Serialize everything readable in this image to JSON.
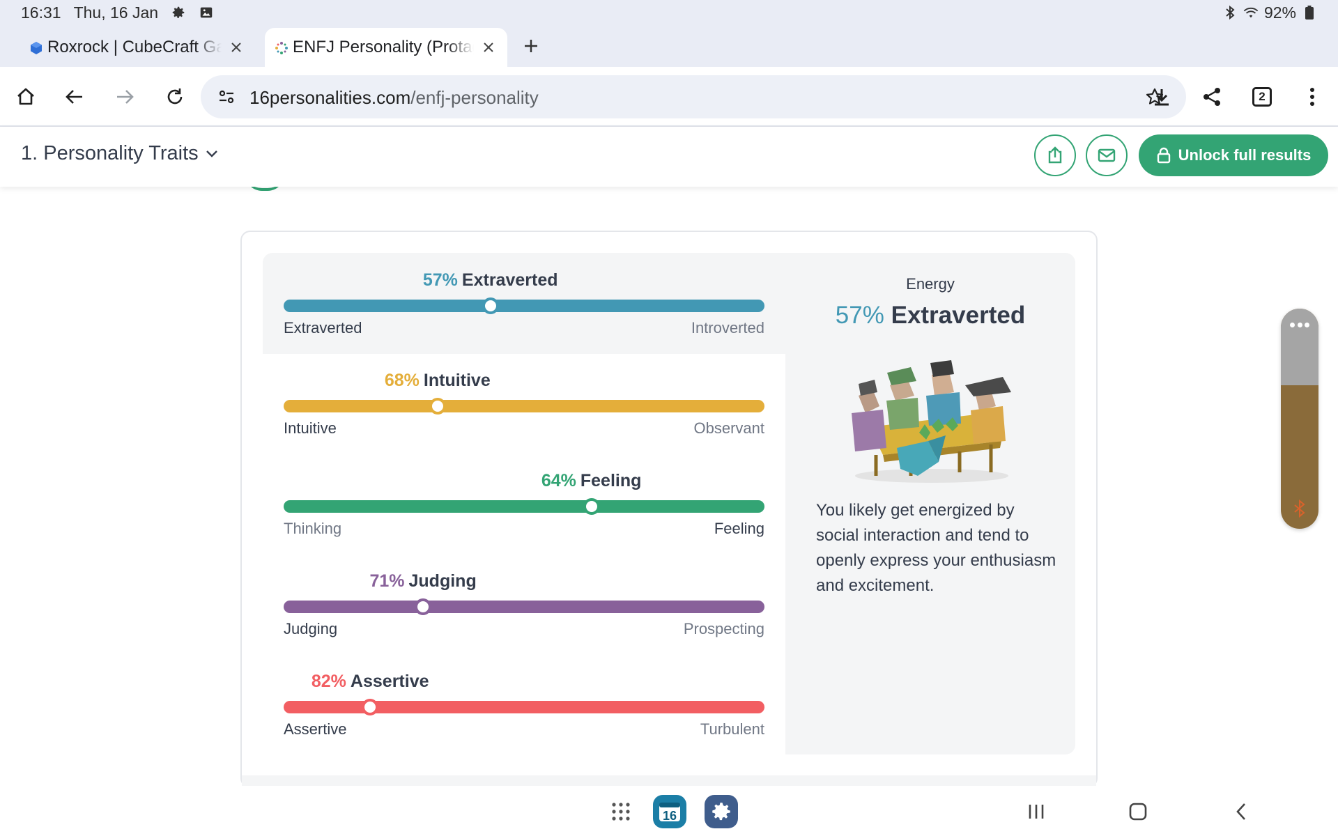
{
  "status_bar": {
    "time": "16:31",
    "date": "Thu, 16 Jan",
    "battery": "92%"
  },
  "tabs": [
    {
      "title": "Roxrock | CubeCraft Games",
      "active": false,
      "favicon": "hexagon-icon"
    },
    {
      "title": "ENFJ Personality (Protagonist)",
      "active": true,
      "favicon": "sparkle-icon"
    }
  ],
  "toolbar": {
    "url_domain": "16personalities.com",
    "url_path": "/enfj-personality",
    "tab_count": "2"
  },
  "page_header": {
    "section": "1. Personality Traits",
    "unlock_label": "Unlock full results"
  },
  "traits": [
    {
      "pct": "57%",
      "name": "Extraverted",
      "left": "Extraverted",
      "right": "Introverted",
      "position": 43,
      "color": "#4298b4",
      "dominant": "left"
    },
    {
      "pct": "68%",
      "name": "Intuitive",
      "left": "Intuitive",
      "right": "Observant",
      "position": 32,
      "color": "#e4ae3a",
      "dominant": "left"
    },
    {
      "pct": "64%",
      "name": "Feeling",
      "left": "Thinking",
      "right": "Feeling",
      "position": 64,
      "color": "#33a474",
      "dominant": "right"
    },
    {
      "pct": "71%",
      "name": "Judging",
      "left": "Judging",
      "right": "Prospecting",
      "position": 29,
      "color": "#88619a",
      "dominant": "left"
    },
    {
      "pct": "82%",
      "name": "Assertive",
      "left": "Assertive",
      "right": "Turbulent",
      "position": 18,
      "color": "#f25e62",
      "dominant": "left"
    }
  ],
  "detail": {
    "kicker": "Energy",
    "pct": "57%",
    "name": "Extraverted",
    "description": "You likely get energized by social interaction and tend to openly express your enthusiasm and excitement."
  },
  "navbar": {
    "app_label": "16"
  }
}
